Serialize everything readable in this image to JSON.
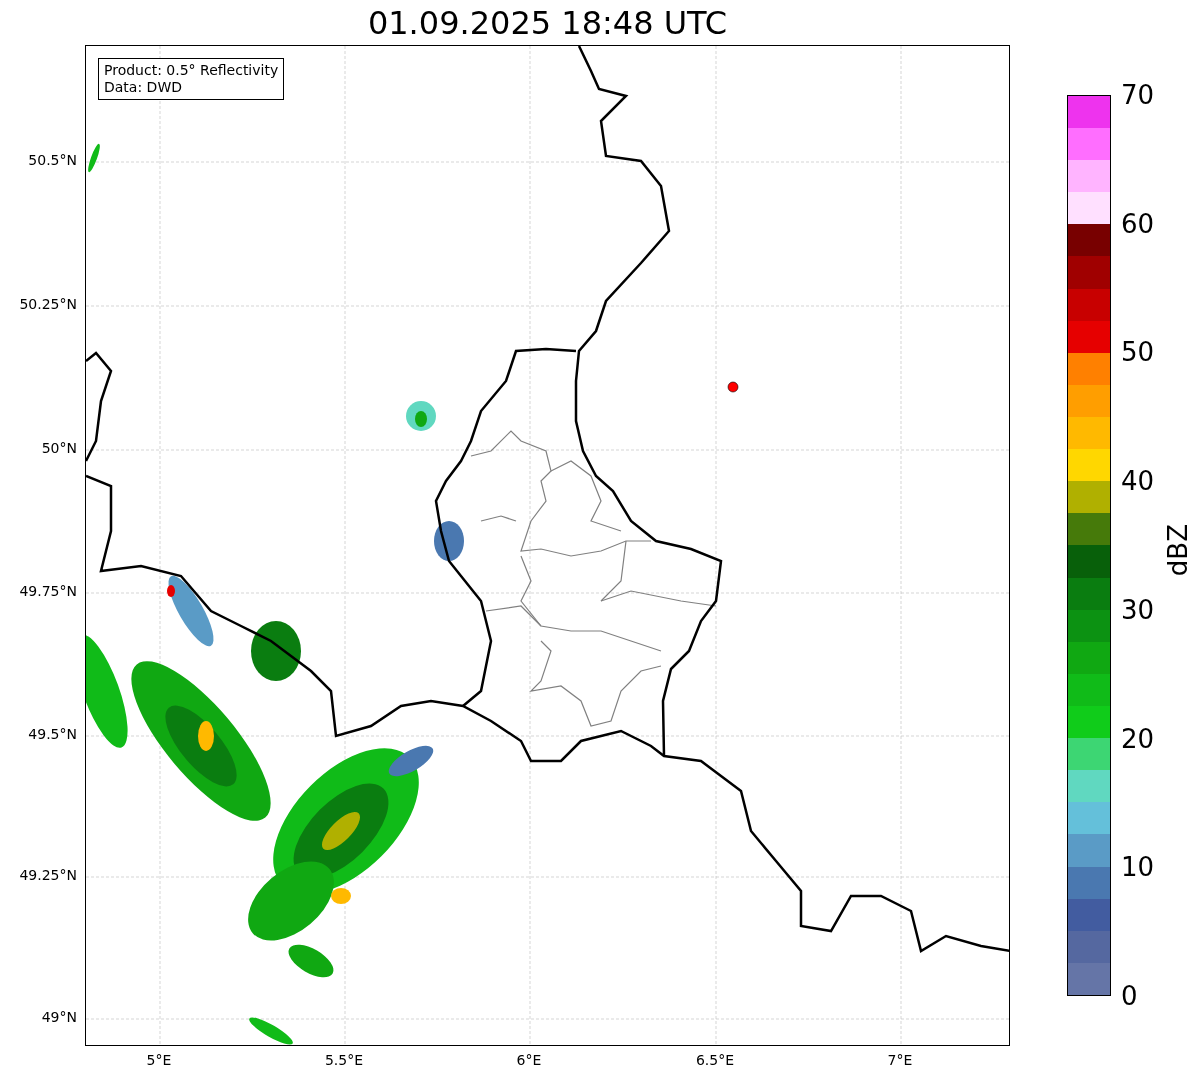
{
  "title": "01.09.2025 18:48 UTC",
  "legend": {
    "lines": [
      "Product: 0.5° Reflectivity",
      "Data: DWD"
    ]
  },
  "map": {
    "lat_ticks": [
      "50.5°N",
      "50.25°N",
      "50°N",
      "49.75°N",
      "49.5°N",
      "49.25°N",
      "49°N"
    ],
    "lon_ticks": [
      "5°E",
      "5.5°E",
      "6°E",
      "6.5°E",
      "7°E"
    ]
  },
  "colorbar": {
    "label": "dBZ",
    "ticks": [
      "70",
      "60",
      "50",
      "40",
      "30",
      "20",
      "10",
      "0"
    ],
    "segments": [
      {
        "color": "#6575a7"
      },
      {
        "color": "#5568a0"
      },
      {
        "color": "#425ca0"
      },
      {
        "color": "#4a78b0"
      },
      {
        "color": "#5a9bc6"
      },
      {
        "color": "#64c0da"
      },
      {
        "color": "#60d8c0"
      },
      {
        "color": "#3dd673"
      },
      {
        "color": "#10cc1a"
      },
      {
        "color": "#10bb18"
      },
      {
        "color": "#10a812"
      },
      {
        "color": "#0c9212"
      },
      {
        "color": "#0a7d10"
      },
      {
        "color": "#08600a"
      },
      {
        "color": "#467a0a"
      },
      {
        "color": "#b0b000"
      },
      {
        "color": "#ffd700"
      },
      {
        "color": "#ffb900"
      },
      {
        "color": "#ff9e00"
      },
      {
        "color": "#ff8000"
      },
      {
        "color": "#e60000"
      },
      {
        "color": "#c80000"
      },
      {
        "color": "#a00000"
      },
      {
        "color": "#780000"
      },
      {
        "color": "#ffe0ff"
      },
      {
        "color": "#ffb4ff"
      },
      {
        "color": "#ff6eff"
      },
      {
        "color": "#ee33ee"
      }
    ]
  }
}
